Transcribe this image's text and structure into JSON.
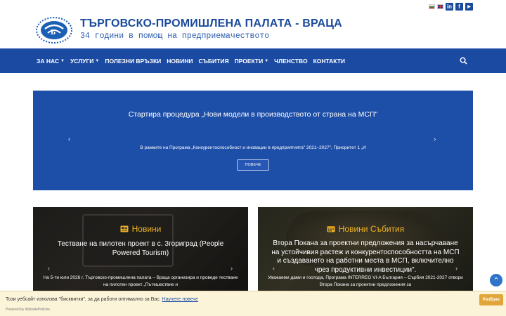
{
  "header": {
    "title": "ТЪРГОВСКО-ПРОМИШЛЕНА ПАЛАТА - ВРАЦА",
    "subtitle": "34 години в помощ на предприемачеството",
    "logo_icon": "tpp-logo-icon",
    "languages": [
      "bg",
      "en"
    ],
    "social": [
      {
        "icon": "linkedin-icon",
        "glyph": "in"
      },
      {
        "icon": "facebook-icon",
        "glyph": "f"
      },
      {
        "icon": "youtube-icon",
        "glyph": "▶"
      }
    ]
  },
  "nav": {
    "items": [
      {
        "label": "ЗА НАС",
        "dropdown": true
      },
      {
        "label": "УСЛУГИ",
        "dropdown": true
      },
      {
        "label": "ПОЛЕЗНИ ВРЪЗКИ",
        "dropdown": false
      },
      {
        "label": "НОВИНИ",
        "dropdown": false
      },
      {
        "label": "СЪБИТИЯ",
        "dropdown": false
      },
      {
        "label": "ПРОЕКТИ",
        "dropdown": true
      },
      {
        "label": "ЧЛЕНСТВО",
        "dropdown": false
      },
      {
        "label": "КОНТАКТИ",
        "dropdown": false
      }
    ],
    "search_icon": "search-icon"
  },
  "hero": {
    "title": "Стартира процедура „Нови модели в производството от страна на МСП\"",
    "text": "В рамките на Програма „Конкурентоспособност и иновации в предприятията\" 2021–2027\", Приоритет 1 „И",
    "button": "ПОВЕЧЕ"
  },
  "cards": [
    {
      "category": "Новини",
      "category_icon": "newspaper-icon",
      "title": "Тестване на пилотен проект в с. Згориград (People Powered Tourism)",
      "text": "На 5-ти юли 2026 г. Търговско-промишлена палата – Враца организира и проведе тестване на пилотен проект „Пътешествие и"
    },
    {
      "category": "Новини Събития",
      "category_icon": "calendar-icon",
      "title": "Втора Покана за проектни предложения за насърчаване на устойчивия растеж и конкурентоспособността на МСП и създаването на работни места в МСП, включително чрез продуктивни инвестиции\".",
      "text": "Уважаеми дами и господа, Програма INTERREG VI-A България – Сърбия 2021-2027 отвори Втора Покана за проектни предложения за"
    }
  ],
  "cookie": {
    "text": "Този уебсайт използва \"бисквитки\", за да работи оптимално за Вас.",
    "link": "Научете повече",
    "powered": "Powered by WebsitePolicies",
    "button": "Разбрах"
  },
  "colors": {
    "brand_blue": "#1b4aa3",
    "accent_gold": "#f0b323",
    "cookie_bg": "#fcf4d8",
    "cookie_button": "#e0a63a"
  }
}
